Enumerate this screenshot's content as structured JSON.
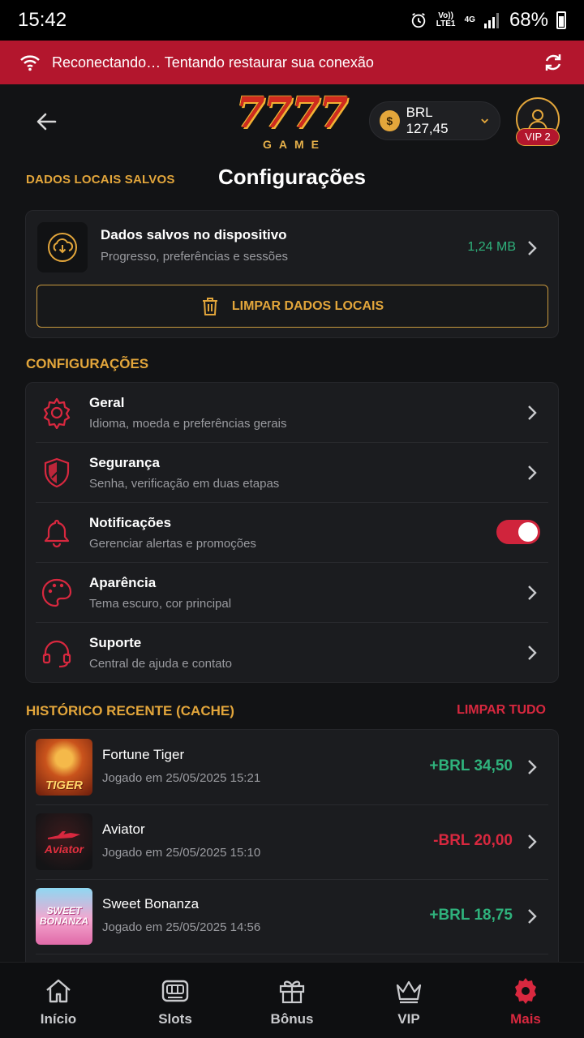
{
  "status_bar": {
    "time": "15:42",
    "network": "Vo)) LTE1",
    "signal_type": "4G",
    "battery": "68%"
  },
  "banner": {
    "text": "Reconectando… Tentando restaurar sua conexão",
    "color": "#b3162d"
  },
  "header": {
    "logo_number": "7777",
    "logo_sub": "GAME",
    "balance": "BRL 127,45",
    "coin_symbol": "$",
    "vip_badge": "VIP 2"
  },
  "page": {
    "saved_label": "DADOS LOCAIS SALVOS",
    "title": "Configurações"
  },
  "local_data": {
    "title": "Dados salvos no dispositivo",
    "subtitle": "Progresso, preferências e sessões",
    "size": "1,24 MB",
    "clear_button": "LIMPAR DADOS LOCAIS"
  },
  "settings": {
    "section_label": "CONFIGURAÇÕES",
    "items": [
      {
        "title": "Geral",
        "subtitle": "Idioma, moeda e preferências gerais",
        "icon": "gear-icon"
      },
      {
        "title": "Segurança",
        "subtitle": "Senha, verificação em duas etapas",
        "icon": "shield-icon"
      },
      {
        "title": "Notificações",
        "subtitle": "Gerenciar alertas e promoções",
        "icon": "bell-icon",
        "toggle_on": true
      },
      {
        "title": "Aparência",
        "subtitle": "Tema escuro, cor principal",
        "icon": "palette-icon"
      },
      {
        "title": "Suporte",
        "subtitle": "Central de ajuda e contato",
        "icon": "headset-icon"
      }
    ]
  },
  "history": {
    "section_label": "HISTÓRICO RECENTE (CACHE)",
    "clear_all": "LIMPAR TUDO",
    "items": [
      {
        "title": "Fortune Tiger",
        "subtitle": "Jogado em 25/05/2025 15:21",
        "amount": "+BRL 34,50",
        "positive": true,
        "thumb_text": "TIGER"
      },
      {
        "title": "Aviator",
        "subtitle": "Jogado em 25/05/2025 15:10",
        "amount": "-BRL 20,00",
        "positive": false,
        "thumb_text": "Aviator"
      },
      {
        "title": "Sweet Bonanza",
        "subtitle": "Jogado em 25/05/2025 14:56",
        "amount": "+BRL 18,75",
        "positive": true,
        "thumb_text": "SWEET BONANZA"
      }
    ]
  },
  "nav": {
    "items": [
      {
        "label": "Início",
        "icon": "home-icon"
      },
      {
        "label": "Slots",
        "icon": "slot-machine-icon"
      },
      {
        "label": "Bônus",
        "icon": "gift-icon"
      },
      {
        "label": "VIP",
        "icon": "crown-icon"
      },
      {
        "label": "Mais",
        "icon": "gear-icon",
        "active": true
      }
    ]
  },
  "colors": {
    "accent_gold": "#e3a63b",
    "accent_red": "#d8283f",
    "positive": "#2fb27c",
    "background": "#121315",
    "card": "#1b1c1f"
  }
}
